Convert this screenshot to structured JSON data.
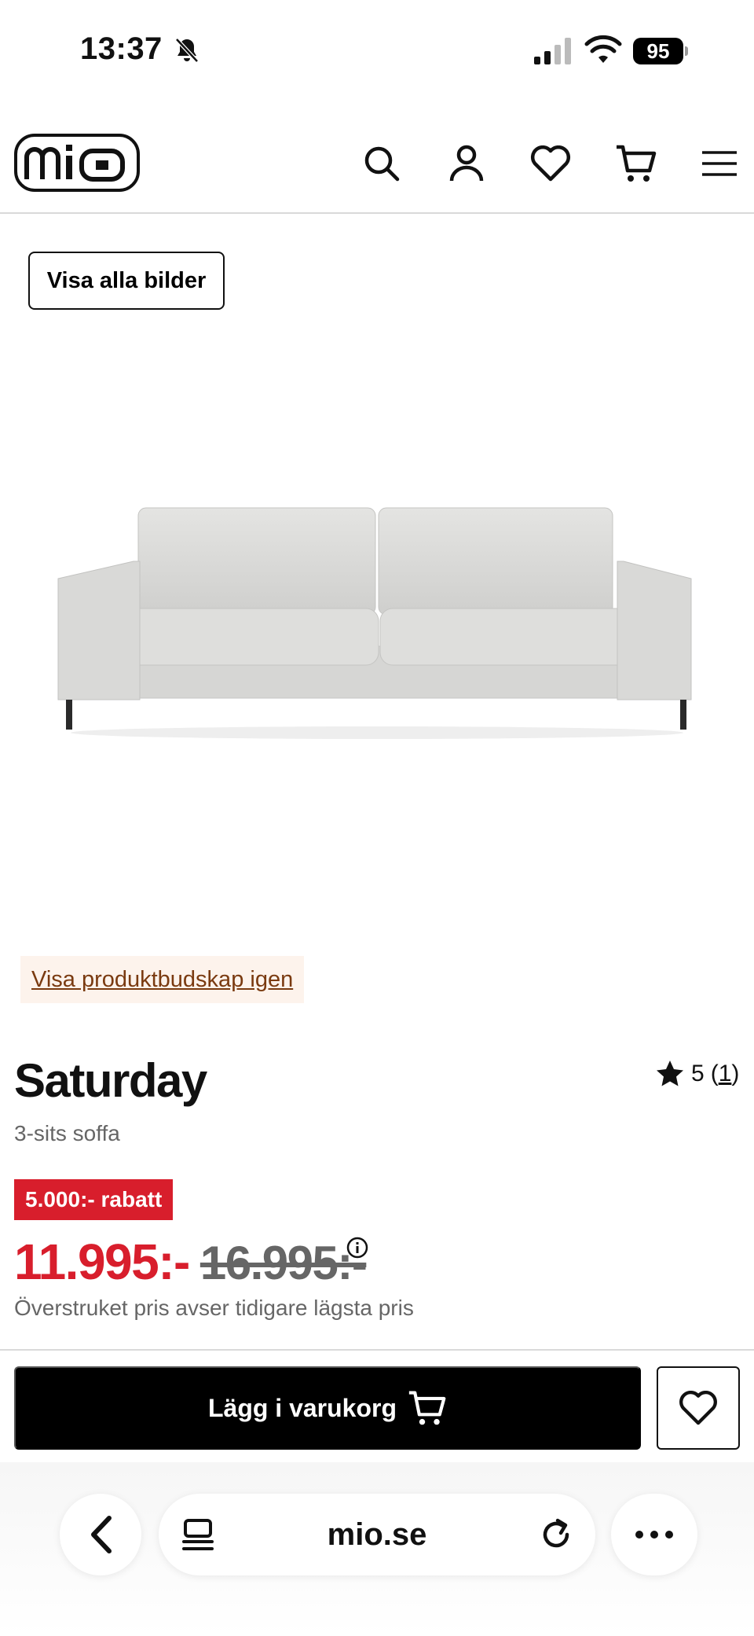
{
  "status_bar": {
    "time": "13:37",
    "battery": "95",
    "icons": [
      "bell-slash-icon",
      "signal-icon",
      "wifi-icon",
      "battery-icon"
    ]
  },
  "header": {
    "logo_text": "mio",
    "icons": [
      "search-icon",
      "user-icon",
      "heart-icon",
      "cart-icon",
      "menu-icon"
    ]
  },
  "gallery": {
    "show_all_label": "Visa alla bilder",
    "message_link": "Visa produktbudskap igen"
  },
  "product": {
    "title": "Saturday",
    "subtitle": "3-sits soffa",
    "rating_value": "5",
    "rating_open": "(",
    "rating_count": "1",
    "rating_close": ")",
    "discount_badge": "5.000:- rabatt",
    "price_current": "11.995:-",
    "price_old": "16.995:-",
    "price_note": "Överstruket pris avser tidigare lägsta pris"
  },
  "actions": {
    "add_to_cart_label": "Lägg i varukorg"
  },
  "browser": {
    "url": "mio.se"
  },
  "colors": {
    "accent_red": "#d81e2c",
    "link_brown": "#7a3a10",
    "link_bg": "#fdf3ec",
    "button_black": "#000000"
  }
}
